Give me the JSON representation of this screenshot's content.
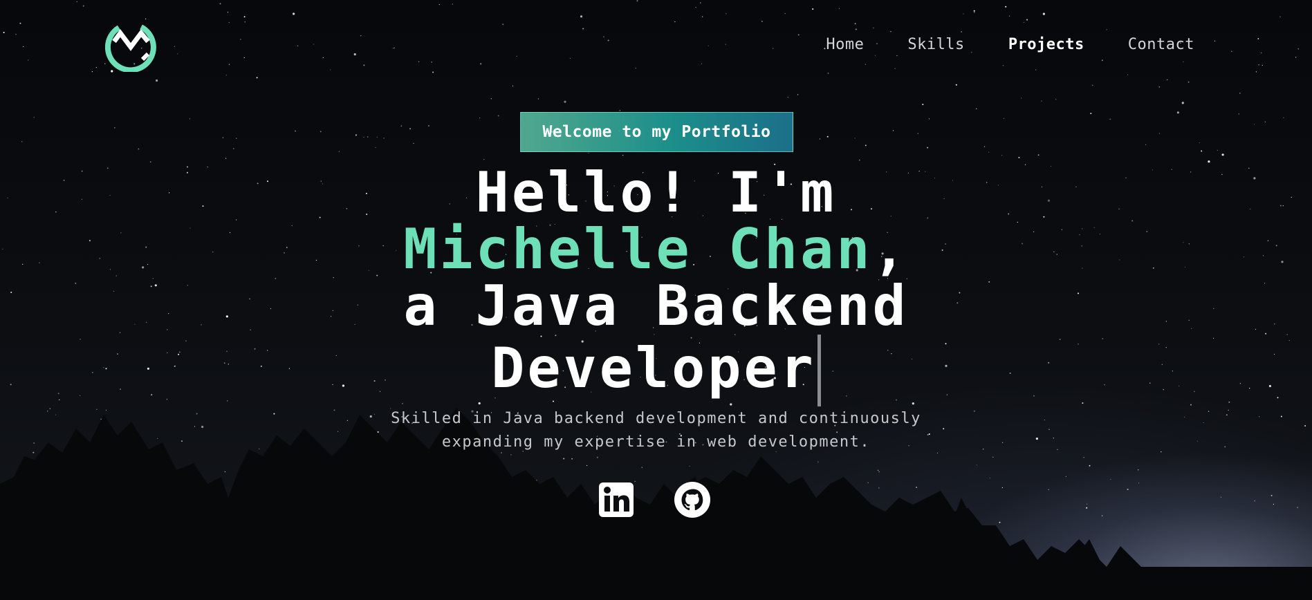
{
  "brand": {
    "logo": "m-circle-logo-icon",
    "accent": "#6ee0b8"
  },
  "nav": {
    "items": [
      {
        "label": "Home"
      },
      {
        "label": "Skills"
      },
      {
        "label": "Projects",
        "active": true
      },
      {
        "label": "Contact"
      }
    ]
  },
  "hero": {
    "badge": "Welcome to my Portfolio",
    "line1": "Hello! I'm",
    "name": "Michelle Chan",
    "comma": ",",
    "line3": "a Java Backend",
    "line4": "Developer",
    "subtitle_line1": "Skilled in Java backend development and continuously",
    "subtitle_line2": "expanding my expertise in web development."
  },
  "social": [
    {
      "name": "linkedin-icon"
    },
    {
      "name": "github-icon"
    }
  ]
}
